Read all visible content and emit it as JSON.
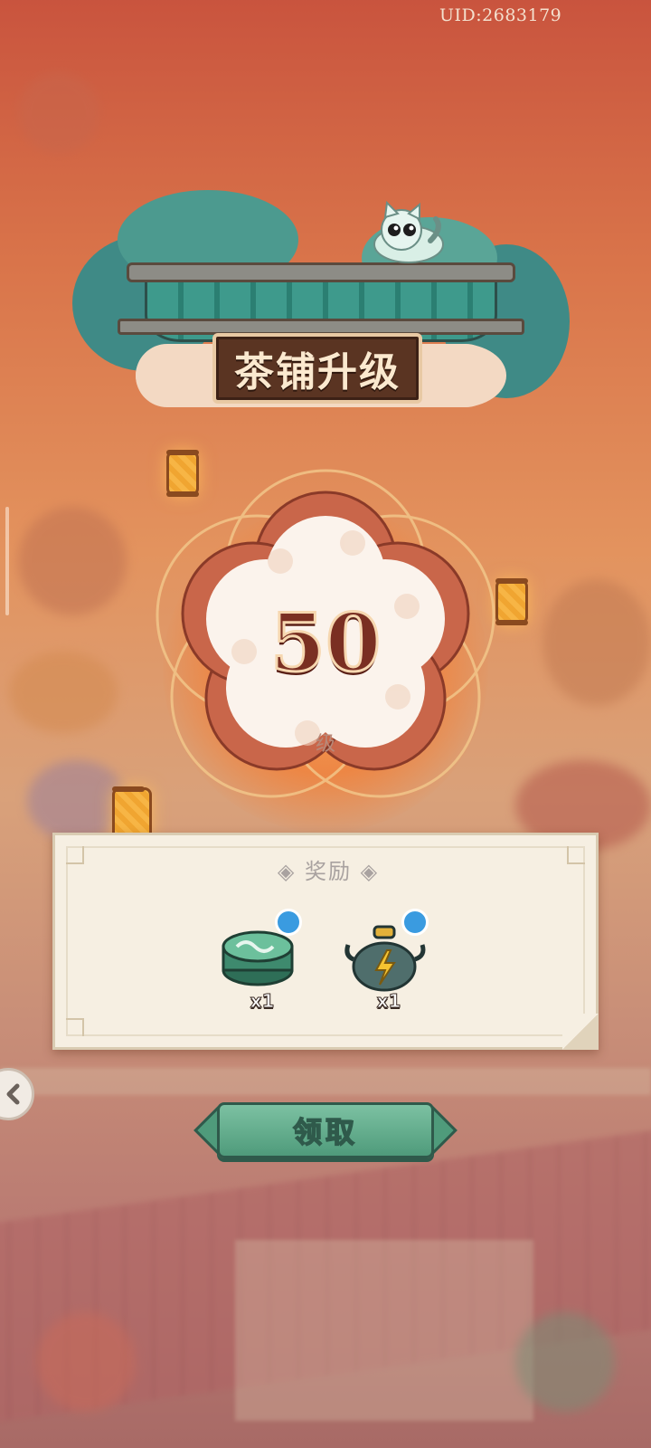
{
  "status": {
    "uid": "UID:2683179"
  },
  "header": {
    "title": "茶铺升级"
  },
  "level": {
    "number": "50",
    "unit": "级"
  },
  "rewards": {
    "title": "◈ 奖励 ◈",
    "items": [
      {
        "icon": "tea-tin-icon",
        "quantity": "x1"
      },
      {
        "icon": "lightning-teapot-icon",
        "quantity": "x1"
      }
    ]
  },
  "actions": {
    "claim_label": "领取"
  },
  "colors": {
    "accent": "#4f9b7b",
    "plaque": "#5a3422",
    "level_text": "#7a2f22"
  }
}
